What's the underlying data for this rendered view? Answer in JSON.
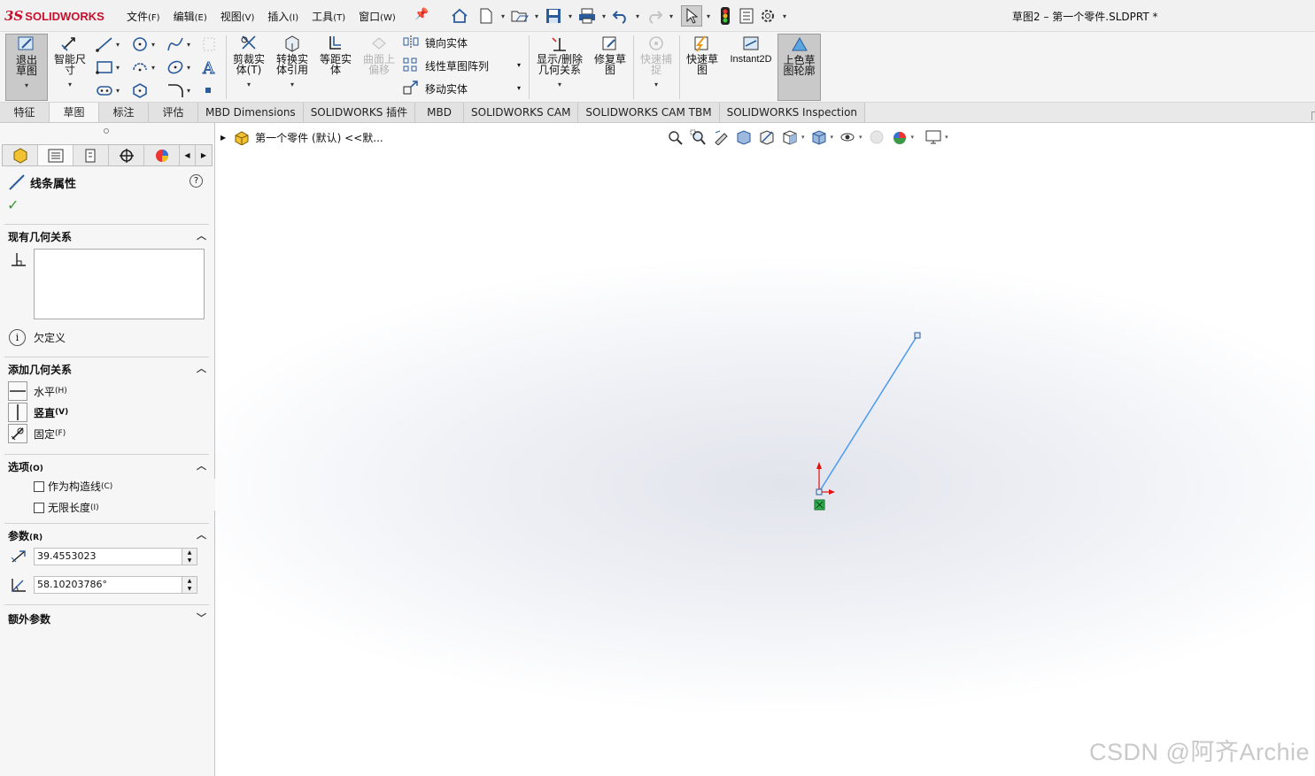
{
  "app": {
    "brand_ds": "3S",
    "brand_name": "SOLIDWORKS",
    "document_title": "草图2 – 第一个零件.SLDPRT *"
  },
  "menus": [
    {
      "label": "文件",
      "key": "(F)"
    },
    {
      "label": "编辑",
      "key": "(E)"
    },
    {
      "label": "视图",
      "key": "(V)"
    },
    {
      "label": "插入",
      "key": "(I)"
    },
    {
      "label": "工具",
      "key": "(T)"
    },
    {
      "label": "窗口",
      "key": "(W)"
    }
  ],
  "commands": {
    "exit_sketch": "退出草图",
    "smart_dim": "智能尺寸",
    "trim": "剪裁实体(T)",
    "convert": "转换实体引用",
    "offset": "等距实体",
    "surface_offset": "曲面上偏移",
    "mirror": "镜向实体",
    "linear_pattern": "线性草图阵列",
    "move": "移动实体",
    "display_relations": "显示/删除几何关系",
    "repair": "修复草图",
    "quick_snaps": "快速捕捉",
    "rapid_sketch": "快速草图",
    "instant2d": "Instant2D",
    "shaded_contours": "上色草图轮廓"
  },
  "tabs": [
    {
      "label": "特征",
      "active": false
    },
    {
      "label": "草图",
      "active": true
    },
    {
      "label": "标注",
      "active": false
    },
    {
      "label": "评估",
      "active": false
    },
    {
      "label": "MBD Dimensions",
      "active": false
    },
    {
      "label": "SOLIDWORKS 插件",
      "active": false
    },
    {
      "label": "MBD",
      "active": false
    },
    {
      "label": "SOLIDWORKS CAM",
      "active": false
    },
    {
      "label": "SOLIDWORKS CAM TBM",
      "active": false
    },
    {
      "label": "SOLIDWORKS Inspection",
      "active": false
    }
  ],
  "property_manager": {
    "title": "线条属性",
    "help": "?",
    "existing_relations": {
      "header": "现有几何关系",
      "status": "欠定义"
    },
    "add_relations": {
      "header": "添加几何关系",
      "items": [
        {
          "label": "水平",
          "key": "(H)"
        },
        {
          "label": "竖直",
          "key": "(V)"
        },
        {
          "label": "固定",
          "key": "(F)"
        }
      ]
    },
    "options": {
      "header": "选项",
      "header_key": "(O)",
      "items": [
        {
          "label": "作为构造线",
          "key": "(C)",
          "checked": false
        },
        {
          "label": "无限长度",
          "key": "(I)",
          "checked": false
        }
      ]
    },
    "parameters": {
      "header": "参数",
      "header_key": "(R)",
      "length": "39.4553023",
      "angle": "58.10203786°"
    },
    "additional": {
      "header": "额外参数"
    }
  },
  "viewport": {
    "tree_flyout": "第一个零件 (默认) <<默...",
    "line_color": "#4a9bef",
    "watermark": "CSDN @阿齐Archie"
  },
  "colors": {
    "accent_red": "#c8102e",
    "active_tab_bg": "#f6f6f6",
    "check_green": "#2f9a2f"
  }
}
